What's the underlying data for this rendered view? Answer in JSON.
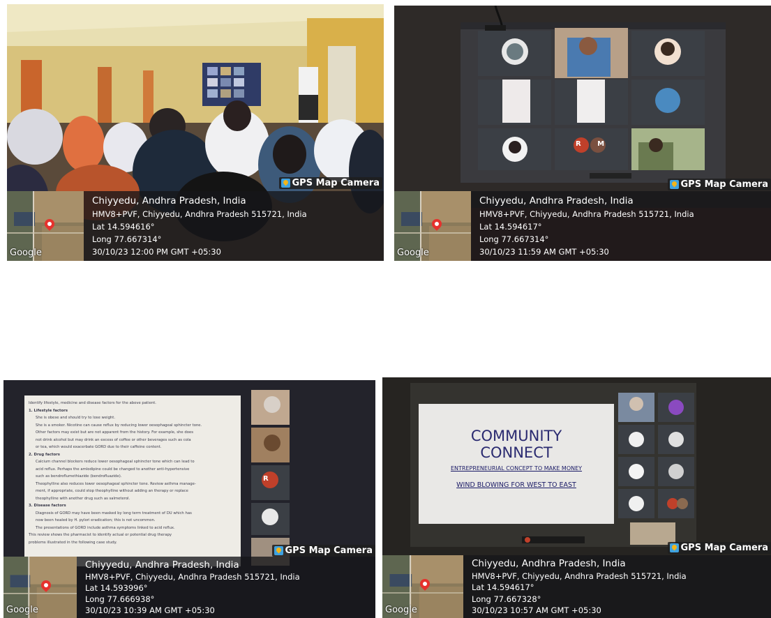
{
  "photos": [
    {
      "brand": "GPS Map Camera",
      "map_label": "Google",
      "place": "Chiyyedu, Andhra Pradesh, India",
      "address": "HMV8+PVF, Chiyyedu, Andhra Pradesh 515721, India",
      "lat": "Lat 14.594616°",
      "long": "Long 77.667314°",
      "datetime": "30/10/23 12:00 PM GMT +05:30"
    },
    {
      "brand": "GPS Map Camera",
      "map_label": "Google",
      "place": "Chiyyedu, Andhra Pradesh, India",
      "address": "HMV8+PVF, Chiyyedu, Andhra Pradesh 515721, India",
      "lat": "Lat 14.594617°",
      "long": "Long 77.667314°",
      "datetime": "30/10/23 11:59 AM GMT +05:30"
    },
    {
      "brand": "GPS Map Camera",
      "map_label": "Google",
      "place": "Chiyyedu, Andhra Pradesh, India",
      "address": "HMV8+PVF, Chiyyedu, Andhra Pradesh 515721, India",
      "lat": "Lat 14.593996°",
      "long": "Long 77.666938°",
      "datetime": "30/10/23 10:39 AM GMT +05:30"
    },
    {
      "brand": "GPS Map Camera",
      "map_label": "Google",
      "place": "Chiyyedu, Andhra Pradesh, India",
      "address": "HMV8+PVF, Chiyyedu, Andhra Pradesh 515721, India",
      "lat": "Lat 14.594617°",
      "long": "Long 77.667328°",
      "datetime": "30/10/23 10:57 AM GMT +05:30"
    }
  ],
  "slide": {
    "title1": "COMMUNITY",
    "title2": "CONNECT",
    "subtitle": "ENTREPRENEURIAL CONCEPT TO MAKE MONEY",
    "tagline": "WIND BLOWING FOR WEST TO EAST"
  },
  "avatars": {
    "rm": "R M",
    "r": "R"
  },
  "doc_lines": [
    "Identify lifestyle, medicine and disease factors for the above patient.",
    "1. Lifestyle factors",
    "She is obese and should try to lose weight.",
    "She is a smoker. Nicotine can cause reflux by reducing lower oesophageal sphincter tone.",
    "Other factors may exist but are not apparent from the history. For example, she does",
    "not drink alcohol but may drink an excess of coffee or other beverages such as cola",
    "or tea, which would exacerbate GORD due to their caffeine content.",
    "2. Drug factors",
    "Calcium channel blockers reduce lower oesophageal sphincter tone which can lead to",
    "acid reflux. Perhaps the amlodipine could be changed to another anti-hypertensive",
    "such as bendroflumethiazide (bendrofluazide).",
    "Theophylline also reduces lower oesophageal sphincter tone. Review asthma manage-",
    "ment, if appropriate, could stop theophylline without adding an therapy or replace",
    "theophylline with another drug such as salmeterol.",
    "3. Disease factors",
    "Diagnosis of GORD may have been masked by long term treatment of DU which has",
    "now been healed by H. pylori eradication; this is not uncommon.",
    "The presentations of GORD include asthma symptoms linked to acid reflux.",
    "This review shows the pharmacist to identify actual or potential drug therapy",
    "problems illustrated in the following case study."
  ],
  "colors": {
    "map_pin": "#e5322d",
    "brand_icon": "#3fa2e0",
    "slide_text": "#1a1a66"
  }
}
